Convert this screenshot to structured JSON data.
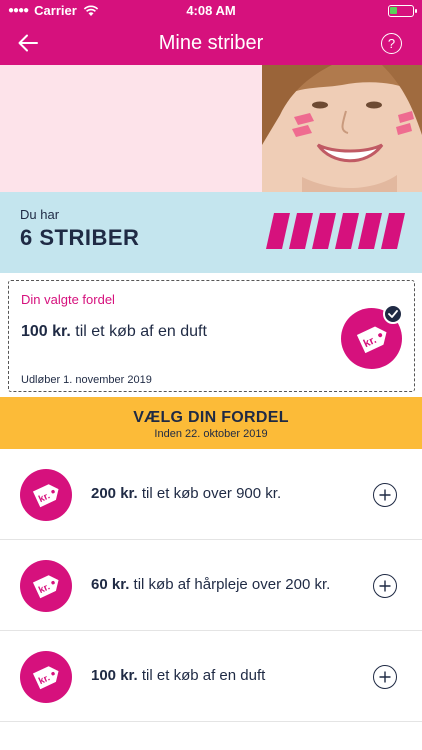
{
  "status_bar": {
    "carrier": "Carrier",
    "time": "4:08 AM"
  },
  "nav": {
    "title": "Mine striber",
    "back_icon": "arrow-left-icon",
    "help_label": "?"
  },
  "stripes": {
    "intro": "Du har",
    "count_label": "6 STRIBER",
    "stripe_count": 6
  },
  "chosen_benefit": {
    "label": "Din valgte fordel",
    "amount": "100 kr.",
    "description": "til et køb af en duft",
    "expiry": "Udløber 1. november 2019",
    "tag_text": "kr."
  },
  "choose": {
    "heading": "VÆLG DIN FORDEL",
    "deadline": "Inden 22. oktober 2019"
  },
  "offers": [
    {
      "amount": "200 kr.",
      "description": "til et køb over 900 kr.",
      "tag_text": "kr."
    },
    {
      "amount": "60 kr.",
      "description": "til køb af hårpleje over 200 kr.",
      "tag_text": "kr."
    },
    {
      "amount": "100 kr.",
      "description": "til et køb af en duft",
      "tag_text": "kr."
    }
  ],
  "colors": {
    "brand_pink": "#d6117d",
    "stripe_blue": "#c4e5ee",
    "hero_pink": "#fde3ea",
    "choose_yellow": "#fcbb38",
    "text_navy": "#1f2a44"
  }
}
